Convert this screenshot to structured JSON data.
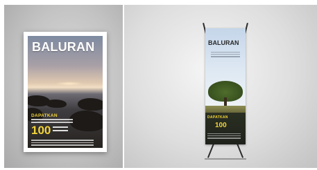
{
  "poster": {
    "title": "BALURAN",
    "subtitle": "DAPATKAN",
    "number": "100",
    "colors": {
      "title": "#ffffff",
      "accent": "#f2d43a"
    }
  },
  "banner": {
    "title": "BALURAN",
    "subtitle": "DAPATKAN",
    "number": "100",
    "colors": {
      "title": "#2b2b2b",
      "accent": "#f2d43a"
    }
  }
}
